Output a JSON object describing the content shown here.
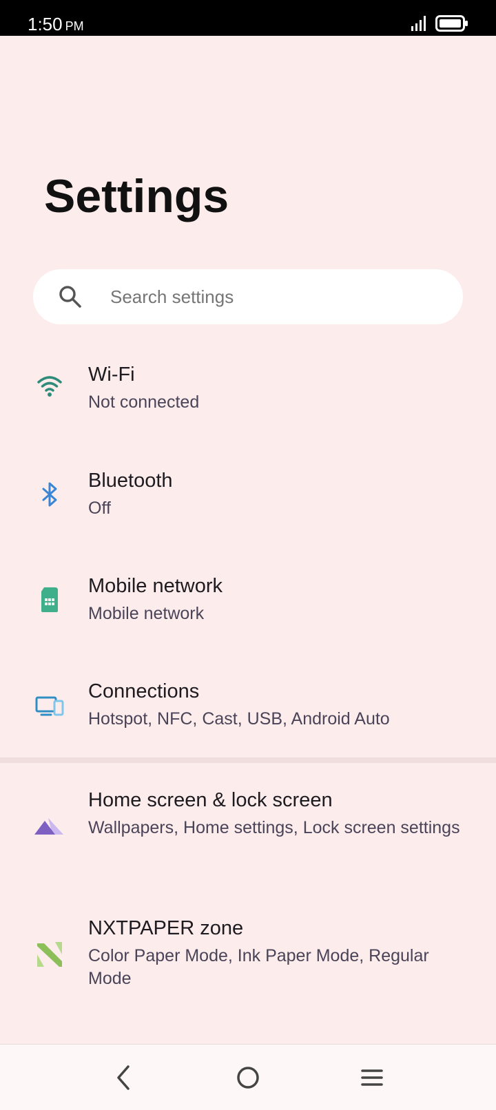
{
  "status_bar": {
    "time": "1:50",
    "ampm": "PM",
    "icons": [
      "signal-icon",
      "battery-icon"
    ]
  },
  "page": {
    "title": "Settings"
  },
  "search": {
    "placeholder": "Search settings",
    "value": "",
    "icon": "search-icon"
  },
  "items": [
    {
      "title": "Wi-Fi",
      "subtitle": "Not connected",
      "icon": "wifi-icon",
      "color": "#2e8b7a"
    },
    {
      "title": "Bluetooth",
      "subtitle": "Off",
      "icon": "bluetooth-icon",
      "color": "#3a86d4"
    },
    {
      "title": "Mobile network",
      "subtitle": "Mobile network",
      "icon": "sim-card-icon",
      "color": "#3fae8a"
    },
    {
      "title": "Connections",
      "subtitle": "Hotspot, NFC, Cast, USB, Android Auto",
      "icon": "devices-icon",
      "color": "#2f8fc4"
    },
    {
      "title": "Home screen & lock screen",
      "subtitle": "Wallpapers, Home settings, Lock screen settings",
      "icon": "mountains-icon",
      "color": "#7e5fc2"
    },
    {
      "title": "NXTPAPER zone",
      "subtitle": "Color Paper Mode, Ink Paper Mode, Regular Mode",
      "icon": "nxtpaper-icon",
      "color": "#8cbf5a"
    }
  ],
  "nav_bar": {
    "buttons": [
      "back-icon",
      "home-icon",
      "menu-icon"
    ]
  }
}
